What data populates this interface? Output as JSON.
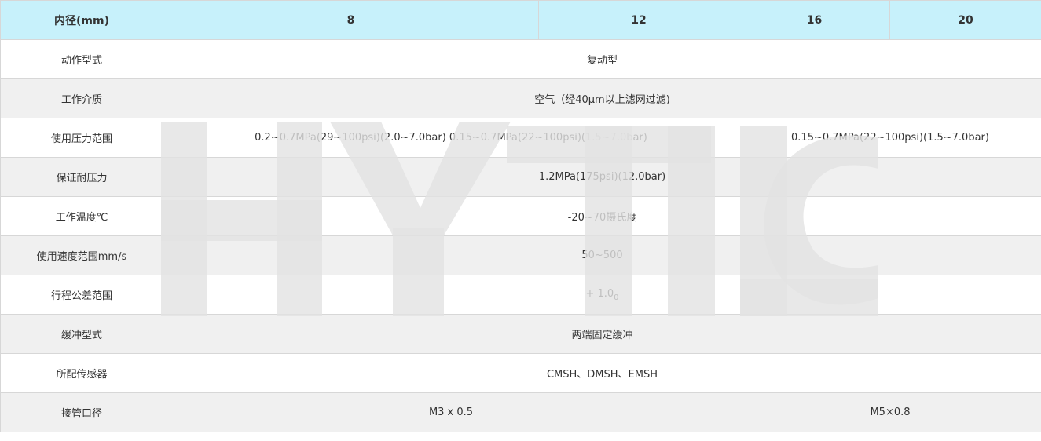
{
  "header": {
    "label": "内径(mm)",
    "bores": [
      "8",
      "12",
      "16",
      "20"
    ]
  },
  "rows": {
    "action": {
      "label": "动作型式",
      "value": "复动型"
    },
    "medium": {
      "label": "工作介质",
      "value": "空气（经40μm以上滤网过滤)"
    },
    "pressure_range": {
      "label": "使用压力范围",
      "value_small": "0.2~0.7MPa(29~100psi)(2.0~7.0bar) 0.15~0.7MPa(22~100psi)(1.5~7.0bar)",
      "value_large": "0.15~0.7MPa(22~100psi)(1.5~7.0bar)"
    },
    "proof_pressure": {
      "label": "保证耐压力",
      "value": "1.2MPa(175psi)(12.0bar)"
    },
    "temperature": {
      "label": "工作温度℃",
      "value": "-20~70摄氏度"
    },
    "speed": {
      "label": "使用速度范围mm/s",
      "value": "50~500"
    },
    "stroke_tolerance": {
      "label": "行程公差范围",
      "value_main": "+ 1.0",
      "value_sub": "0"
    },
    "cushion": {
      "label": "缓冲型式",
      "value": "两端固定缓冲"
    },
    "sensor": {
      "label": "所配传感器",
      "value": "CMSH、DMSH、EMSH"
    },
    "port": {
      "label": "接管口径",
      "value_small": "M3 x 0.5",
      "value_large": "M5×0.8"
    }
  },
  "watermark": {
    "text": "HYTIC",
    "color": "#e2e2e2"
  }
}
